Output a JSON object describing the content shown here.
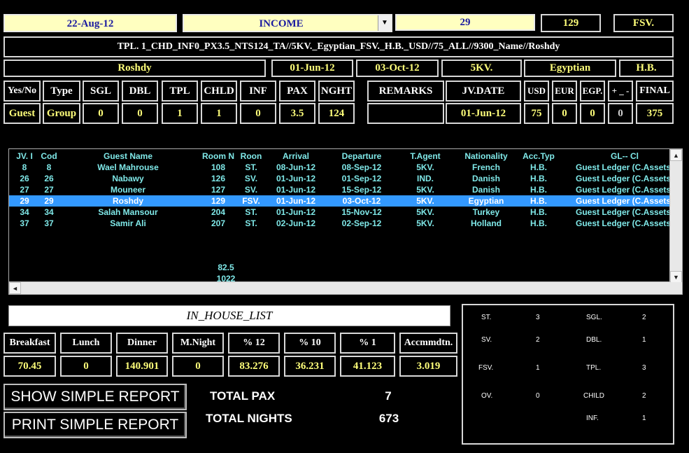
{
  "top": {
    "date": "22-Aug-12",
    "account": "INCOME",
    "jv": "29",
    "room": "129",
    "room_type": "FSV."
  },
  "desc": "TPL. 1_CHD_INF0_PX3.5_NTS124_TA//5KV._Egyptian_FSV._H.B._USD//75_ALL//9300_Name//Roshdy",
  "info": {
    "name": "Roshdy",
    "arrival": "01-Jun-12",
    "departure": "03-Oct-12",
    "agent": "5KV.",
    "nationality": "Egyptian",
    "acc": "H.B."
  },
  "headers": {
    "yesno": "Yes/No",
    "type": "Type",
    "sgl": "SGL",
    "dbl": "DBL",
    "tpl": "TPL",
    "chld": "CHLD",
    "inf": "INF",
    "pax": "PAX",
    "nght": "NGHT",
    "remarks": "REMARKS",
    "jvdate": "JV.DATE",
    "usd": "USD",
    "eur": "EUR",
    "egp": "EGP.",
    "plusminus": "+ _ -",
    "final": "FINAL"
  },
  "values": {
    "yesno": "Guest",
    "type": "Group",
    "sgl": "0",
    "dbl": "0",
    "tpl": "1",
    "chld": "1",
    "inf": "0",
    "pax": "3.5",
    "nght": "124",
    "remarks": "",
    "jvdate": "01-Jun-12",
    "usd": "75",
    "eur": "0",
    "egp": "0",
    "plusminus": "0",
    "final": "375"
  },
  "list": {
    "columns": [
      "JV. I",
      "Cod",
      "Guest Name",
      "Room N",
      "Roon",
      "Arrival",
      "Departure",
      "T.Agent",
      "Nationality",
      "Acc.Typ",
      "GL-- Cl"
    ],
    "rows": [
      [
        "8",
        "8",
        "Wael Mahrouse",
        "108",
        "ST.",
        "08-Jun-12",
        "08-Sep-12",
        "5KV.",
        "French",
        "H.B.",
        "Guest Ledger (C.Assets"
      ],
      [
        "26",
        "26",
        "Nabawy",
        "126",
        "SV.",
        "01-Jun-12",
        "01-Sep-12",
        "IND.",
        "Danish",
        "H.B.",
        "Guest Ledger (C.Assets"
      ],
      [
        "27",
        "27",
        "Mouneer",
        "127",
        "SV.",
        "01-Jun-12",
        "15-Sep-12",
        "5KV.",
        "Danish",
        "H.B.",
        "Guest Ledger (C.Assets"
      ],
      [
        "29",
        "29",
        "Roshdy",
        "129",
        "FSV.",
        "01-Jun-12",
        "03-Oct-12",
        "5KV.",
        "Egyptian",
        "H.B.",
        "Guest Ledger (C.Assets"
      ],
      [
        "34",
        "34",
        "Salah Mansour",
        "204",
        "ST.",
        "01-Jun-12",
        "15-Nov-12",
        "5KV.",
        "Turkey",
        "H.B.",
        "Guest Ledger (C.Assets"
      ],
      [
        "37",
        "37",
        "Samir Ali",
        "207",
        "ST.",
        "02-Jun-12",
        "02-Sep-12",
        "5KV.",
        "Holland",
        "H.B.",
        "Guest Ledger (C.Assets"
      ]
    ],
    "selected_index": 3,
    "total_1": "82.5",
    "total_2": "1022"
  },
  "in_house_label": "IN_HOUSE_LIST",
  "meals": {
    "labels": [
      "Breakfast",
      "Lunch",
      "Dinner",
      "M.Night",
      "% 12",
      "% 10",
      "% 1",
      "Accmmdtn."
    ],
    "values": [
      "70.45",
      "0",
      "140.901",
      "0",
      "83.276",
      "36.231",
      "41.123",
      "3.019"
    ]
  },
  "buttons": {
    "show": "SHOW SIMPLE REPORT",
    "print": "PRINT SIMPLE REPORT"
  },
  "totals": {
    "pax_label": "TOTAL PAX",
    "pax_value": "7",
    "nights_label": "TOTAL NIGHTS",
    "nights_value": "673"
  },
  "stats": {
    "st_label": "ST.",
    "st": "3",
    "sgl_label": "SGL.",
    "sgl": "2",
    "sv_label": "SV.",
    "sv": "2",
    "dbl_label": "DBL.",
    "dbl": "1",
    "fsv_label": "FSV.",
    "fsv": "1",
    "tpl_label": "TPL.",
    "tpl": "3",
    "ov_label": "OV.",
    "ov": "0",
    "child_label": "CHILD",
    "child": "2",
    "inf_label": "INF.",
    "inf": "1"
  },
  "colors": {
    "field_bg": "#ffffc0",
    "field_text": "#1a1aa0",
    "value_yellow": "#ffff7a",
    "list_text": "#7fe8e8",
    "selection": "#3399ff"
  }
}
